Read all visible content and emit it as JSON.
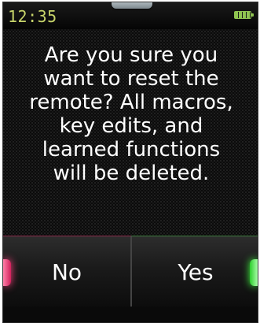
{
  "status_bar": {
    "time": "12:35",
    "battery_icon": "battery-icon",
    "indicator_color": "#c7d46a"
  },
  "dialog": {
    "message": "Are you sure you\nwant to reset the\nremote? All macros,\nkey edits, and\nlearned functions\nwill be deleted."
  },
  "buttons": {
    "no_label": "No",
    "yes_label": "Yes",
    "no_accent": "#ff3f7f",
    "yes_accent": "#3fff3f"
  }
}
